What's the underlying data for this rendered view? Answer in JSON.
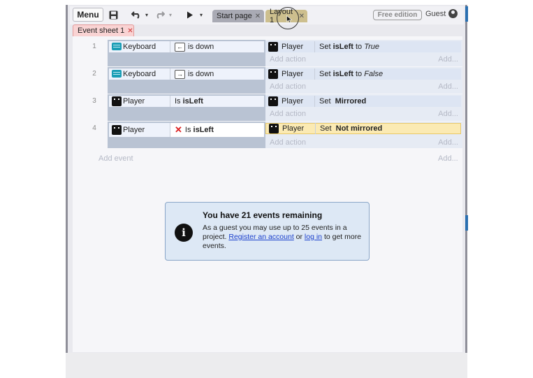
{
  "toolbar": {
    "menu_label": "Menu",
    "save_icon": "floppy-disk-icon",
    "undo_icon": "undo-icon",
    "redo_icon": "redo-icon",
    "play_icon": "play-icon",
    "tabs": [
      {
        "label": "Start page"
      },
      {
        "label": "Layout 1"
      }
    ],
    "edition_badge": "Free edition",
    "user_label": "Guest"
  },
  "sheet_tab": {
    "label": "Event sheet 1"
  },
  "events": [
    {
      "number": "1",
      "condition": {
        "object": "Keyboard",
        "key_symbol": "←",
        "text": "is down"
      },
      "action": {
        "object": "Player",
        "prefix": "Set ",
        "var": "isLeft",
        "mid": " to ",
        "value": "True"
      },
      "add_action": "Add action",
      "add_more": "Add..."
    },
    {
      "number": "2",
      "condition": {
        "object": "Keyboard",
        "key_symbol": "→",
        "text": "is down"
      },
      "action": {
        "object": "Player",
        "prefix": "Set ",
        "var": "isLeft",
        "mid": " to ",
        "value": "False"
      },
      "add_action": "Add action",
      "add_more": "Add..."
    },
    {
      "number": "3",
      "condition": {
        "object": "Player",
        "prefix": "Is ",
        "var": "isLeft"
      },
      "action": {
        "object": "Player",
        "prefix": "Set ",
        "bold": "Mirrored"
      },
      "add_action": "Add action",
      "add_more": "Add..."
    },
    {
      "number": "4",
      "condition": {
        "object": "Player",
        "inverted_symbol": "✕",
        "prefix": "Is ",
        "var": "isLeft"
      },
      "action": {
        "object": "Player",
        "prefix": "Set ",
        "bold": "Not mirrored"
      },
      "add_action": "Add action",
      "add_more": "Add..."
    }
  ],
  "add_event": "Add event",
  "add_event_more": "Add...",
  "notice": {
    "title": "You have 21 events remaining",
    "body_start": "As a guest you may use up to 25 events in a project. ",
    "register_link": "Register an account",
    "or": " or ",
    "login_link": "log in",
    "body_end": " to get more events.",
    "icon_letter": "i"
  },
  "colors": {
    "accent": "#2a6fb0",
    "sheet_tab": "#f9d3d3",
    "highlight": "#fbeab3",
    "notice_bg": "#dde8f5"
  }
}
